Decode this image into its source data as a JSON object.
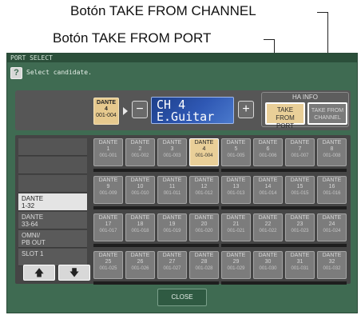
{
  "annotations": {
    "take_from_channel": "Botón TAKE FROM CHANNEL",
    "take_from_port": "Botón TAKE FROM PORT"
  },
  "window": {
    "title": "PORT SELECT",
    "help_icon": "?",
    "help_text": "Select candidate."
  },
  "header": {
    "selected_port": {
      "line1": "DANTE",
      "line2": "4",
      "line3": "001-004"
    },
    "minus_label": "−",
    "plus_label": "+",
    "channel": {
      "number": "CH 4",
      "name": "E.Guitar"
    },
    "ha_info": {
      "label": "HA INFO",
      "take_from_port": "TAKE FROM\nPORT",
      "take_from_channel": "TAKE FROM\nCHANNEL"
    }
  },
  "sidebar": {
    "items": [
      {
        "label": ""
      },
      {
        "label": ""
      },
      {
        "label": ""
      },
      {
        "label": "DANTE\n1-32",
        "active": true
      },
      {
        "label": "DANTE\n33-64"
      },
      {
        "label": "OMNI/\nPB OUT"
      },
      {
        "label": "SLOT 1"
      }
    ],
    "up_icon": "🡅",
    "down_icon": "🡇"
  },
  "ports": [
    {
      "line1": "DANTE",
      "line2": "1",
      "line3": "001-001"
    },
    {
      "line1": "DANTE",
      "line2": "2",
      "line3": "001-002"
    },
    {
      "line1": "DANTE",
      "line2": "3",
      "line3": "001-003"
    },
    {
      "line1": "DANTE",
      "line2": "4",
      "line3": "001-004",
      "selected": true
    },
    {
      "line1": "DANTE",
      "line2": "5",
      "line3": "001-005"
    },
    {
      "line1": "DANTE",
      "line2": "6",
      "line3": "001-006"
    },
    {
      "line1": "DANTE",
      "line2": "7",
      "line3": "001-007"
    },
    {
      "line1": "DANTE",
      "line2": "8",
      "line3": "001-008"
    },
    {
      "line1": "DANTE",
      "line2": "9",
      "line3": "001-009"
    },
    {
      "line1": "DANTE",
      "line2": "10",
      "line3": "001-010"
    },
    {
      "line1": "DANTE",
      "line2": "11",
      "line3": "001-011"
    },
    {
      "line1": "DANTE",
      "line2": "12",
      "line3": "001-012"
    },
    {
      "line1": "DANTE",
      "line2": "13",
      "line3": "001-013"
    },
    {
      "line1": "DANTE",
      "line2": "14",
      "line3": "001-014"
    },
    {
      "line1": "DANTE",
      "line2": "15",
      "line3": "001-015"
    },
    {
      "line1": "DANTE",
      "line2": "16",
      "line3": "001-016"
    },
    {
      "line1": "DANTE",
      "line2": "17",
      "line3": "001-017"
    },
    {
      "line1": "DANTE",
      "line2": "18",
      "line3": "001-018"
    },
    {
      "line1": "DANTE",
      "line2": "19",
      "line3": "001-019"
    },
    {
      "line1": "DANTE",
      "line2": "20",
      "line3": "001-020"
    },
    {
      "line1": "DANTE",
      "line2": "21",
      "line3": "001-021"
    },
    {
      "line1": "DANTE",
      "line2": "22",
      "line3": "001-022"
    },
    {
      "line1": "DANTE",
      "line2": "23",
      "line3": "001-023"
    },
    {
      "line1": "DANTE",
      "line2": "24",
      "line3": "001-024"
    },
    {
      "line1": "DANTE",
      "line2": "25",
      "line3": "001-025"
    },
    {
      "line1": "DANTE",
      "line2": "26",
      "line3": "001-026"
    },
    {
      "line1": "DANTE",
      "line2": "27",
      "line3": "001-027"
    },
    {
      "line1": "DANTE",
      "line2": "28",
      "line3": "001-028"
    },
    {
      "line1": "DANTE",
      "line2": "29",
      "line3": "001-029"
    },
    {
      "line1": "DANTE",
      "line2": "30",
      "line3": "001-030"
    },
    {
      "line1": "DANTE",
      "line2": "31",
      "line3": "001-031"
    },
    {
      "line1": "DANTE",
      "line2": "32",
      "line3": "001-032"
    }
  ],
  "footer": {
    "close_label": "CLOSE"
  }
}
